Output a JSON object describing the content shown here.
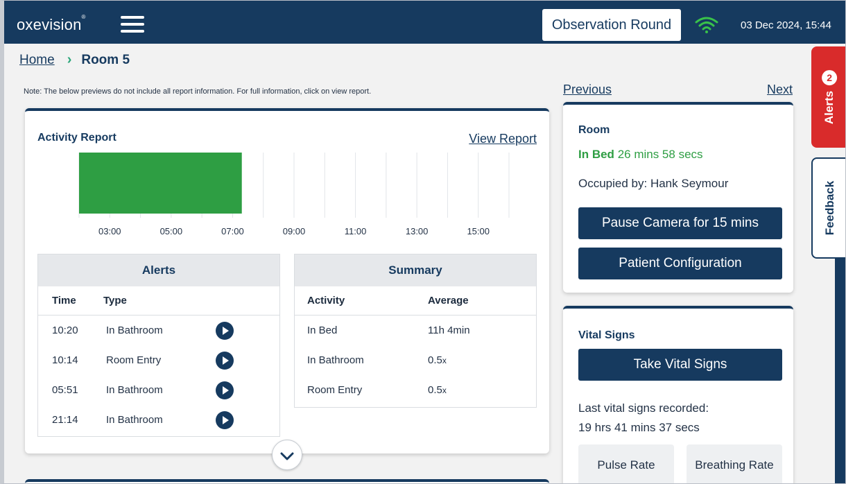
{
  "header": {
    "logo": "oxevision",
    "logo_mark": "®",
    "observation_button": "Observation Round",
    "datetime": "03 Dec 2024, 15:44",
    "icons": {
      "menu": "hamburger-menu-icon",
      "wifi": "wifi-icon"
    },
    "colors": {
      "bar": "#163a5f",
      "wifi": "#39c24a"
    }
  },
  "breadcrumb": {
    "home": "Home",
    "separator": "›",
    "current": "Room 5"
  },
  "note": "Note: The below previews do not include all report information. For full information, click on view report.",
  "activity": {
    "title": "Activity Report",
    "view_report": "View Report",
    "chart_data": {
      "type": "bar",
      "title": "",
      "x_ticks": [
        "03:00",
        "05:00",
        "07:00",
        "09:00",
        "11:00",
        "13:00",
        "15:00"
      ],
      "x_range_hours": [
        2,
        16
      ],
      "bars": [
        {
          "start": 2.0,
          "end": 7.3,
          "activity": "In Bed",
          "color": "#2e9e43"
        }
      ]
    },
    "alerts_table": {
      "title": "Alerts",
      "columns": [
        "Time",
        "Type"
      ],
      "rows": [
        {
          "time": "10:20",
          "type": "In Bathroom"
        },
        {
          "time": "10:14",
          "type": "Room Entry"
        },
        {
          "time": "05:51",
          "type": "In Bathroom"
        },
        {
          "time": "21:14",
          "type": "In Bathroom"
        }
      ]
    },
    "summary_table": {
      "title": "Summary",
      "columns": [
        "Activity",
        "Average"
      ],
      "rows": [
        {
          "activity": "In Bed",
          "average": "11h 4min"
        },
        {
          "activity": "In Bathroom",
          "average": "0.5",
          "unit": "x"
        },
        {
          "activity": "Room Entry",
          "average": "0.5",
          "unit": "x"
        }
      ]
    }
  },
  "pager": {
    "previous": "Previous",
    "next": "Next"
  },
  "room": {
    "title": "Room",
    "status": "In Bed",
    "duration": "26 mins 58 secs",
    "occupied": "Occupied by: Hank Seymour",
    "pause_button": "Pause Camera for 15 mins",
    "config_button": "Patient Configuration",
    "status_color": "#2e9e43"
  },
  "vitals": {
    "title": "Vital Signs",
    "take_button": "Take Vital Signs",
    "last_label": "Last vital signs recorded:",
    "last_value": "19 hrs 41 mins 37 secs",
    "pulse": "Pulse Rate",
    "breathing": "Breathing Rate"
  },
  "side_tabs": {
    "alerts": "Alerts",
    "alerts_count": "2",
    "feedback": "Feedback",
    "alert_color": "#d92b2b"
  }
}
